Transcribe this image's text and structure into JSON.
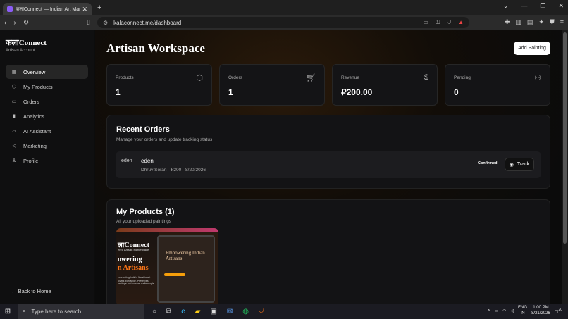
{
  "browser": {
    "tab_title": "कलाConnect — Indian Art Marke",
    "url": "kalaconnect.me/dashboard"
  },
  "sidebar": {
    "brand": "कलाConnect",
    "brand_sub": "Artisan Account",
    "items": [
      {
        "label": "Overview",
        "icon": "grid-icon"
      },
      {
        "label": "My Products",
        "icon": "package-icon"
      },
      {
        "label": "Orders",
        "icon": "card-icon"
      },
      {
        "label": "Analytics",
        "icon": "chart-icon"
      },
      {
        "label": "AI Assistant",
        "icon": "chat-icon"
      },
      {
        "label": "Marketing",
        "icon": "megaphone-icon"
      },
      {
        "label": "Profile",
        "icon": "user-icon"
      }
    ],
    "back": "← Back to Home"
  },
  "main": {
    "title": "Artisan Workspace",
    "add_button": "Add Painting",
    "stats": [
      {
        "label": "Products",
        "value": "1"
      },
      {
        "label": "Orders",
        "value": "1"
      },
      {
        "label": "Revenue",
        "value": "₽200.00"
      },
      {
        "label": "Pending",
        "value": "0"
      }
    ],
    "recent_orders": {
      "title": "Recent Orders",
      "subtitle": "Manage your orders and update tracking status",
      "order": {
        "thumb_alt": "eden",
        "name": "eden",
        "detail": "Dhruv Soran · ₽200 · 8/20/2026",
        "status": "Confirmed",
        "track": "Track"
      }
    },
    "products": {
      "title": "My Products (1)",
      "subtitle": "All your uploaded paintings",
      "card": {
        "line1": "लाConnect",
        "line2": "ered Artisan Marketplace",
        "line3": "owering",
        "line4": "n Artisans",
        "line5": "connecting India's finest to art lovers worldwide. Preserves heritage and powers craftspeople.",
        "screen_heading": "Empowering Indian Artisans"
      }
    }
  },
  "taskbar": {
    "search_placeholder": "Type here to search",
    "lang": "ENG",
    "region": "IN",
    "time": "1:00 PM",
    "date": "8/21/2026",
    "notif": "20"
  }
}
